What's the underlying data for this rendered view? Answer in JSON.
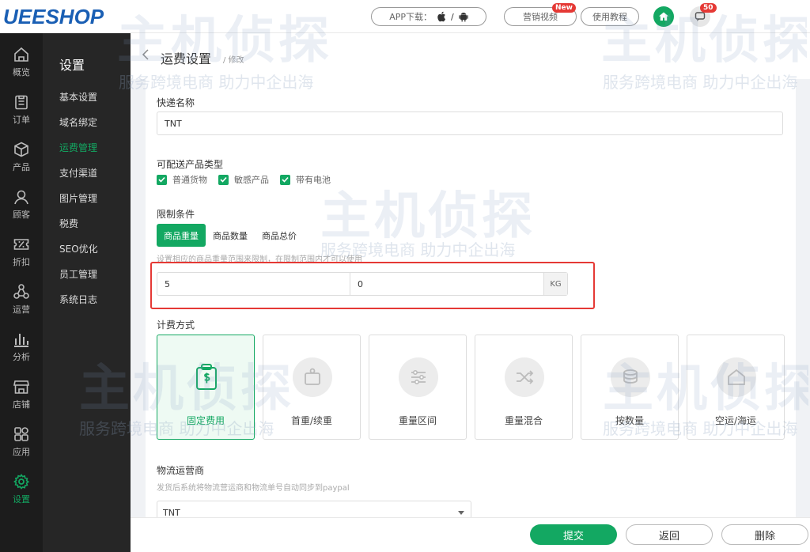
{
  "app": {
    "logo": "UEESHOP",
    "app_download": "APP下载：",
    "app_sep": "/",
    "marketing_video": "营销视频",
    "new_badge": "New",
    "tutorial": "使用教程",
    "msg_count": "50"
  },
  "iconbar": [
    {
      "label": "概览",
      "icon": "home-outline-icon"
    },
    {
      "label": "订单",
      "icon": "clipboard-icon"
    },
    {
      "label": "产品",
      "icon": "cube-icon"
    },
    {
      "label": "顾客",
      "icon": "user-icon"
    },
    {
      "label": "折扣",
      "icon": "discount-icon"
    },
    {
      "label": "运营",
      "icon": "network-icon"
    },
    {
      "label": "分析",
      "icon": "bar-chart-icon"
    },
    {
      "label": "店铺",
      "icon": "store-icon"
    },
    {
      "label": "应用",
      "icon": "apps-icon"
    },
    {
      "label": "设置",
      "icon": "gear-icon"
    }
  ],
  "subnav": {
    "title": "设置",
    "items": [
      "基本设置",
      "域名绑定",
      "运费管理",
      "支付渠道",
      "图片管理",
      "税费",
      "SEO优化",
      "员工管理",
      "系统日志"
    ]
  },
  "page": {
    "title": "运费设置",
    "subtitle": "/ 修改"
  },
  "form": {
    "courier_label": "快递名称",
    "courier_value": "TNT",
    "product_types_label": "可配送产品类型",
    "product_types": [
      "普通货物",
      "敏感产品",
      "带有电池"
    ],
    "limit_label": "限制条件",
    "limit_tabs": [
      "商品重量",
      "商品数量",
      "商品总价"
    ],
    "limit_hint": "设置相应的商品重量范围来限制，在限制范围内才可以使用",
    "weight_min": "5",
    "weight_max": "0",
    "weight_unit": "KG",
    "billing_label": "计费方式",
    "billing_methods": [
      "固定费用",
      "首重/续重",
      "重量区间",
      "重量混合",
      "按数量",
      "空运/海运"
    ],
    "carrier_label": "物流运营商",
    "carrier_hint": "发货后系统将物流营运商和物流单号自动同步到paypal",
    "carrier_value": "TNT"
  },
  "footer": {
    "submit": "提交",
    "back": "返回",
    "delete": "删除"
  },
  "watermark": {
    "text": "服务跨境电商 助力中企出海",
    "brand": "主机侦探"
  },
  "colors": {
    "accent": "#13a862",
    "highlight": "#e53935"
  }
}
